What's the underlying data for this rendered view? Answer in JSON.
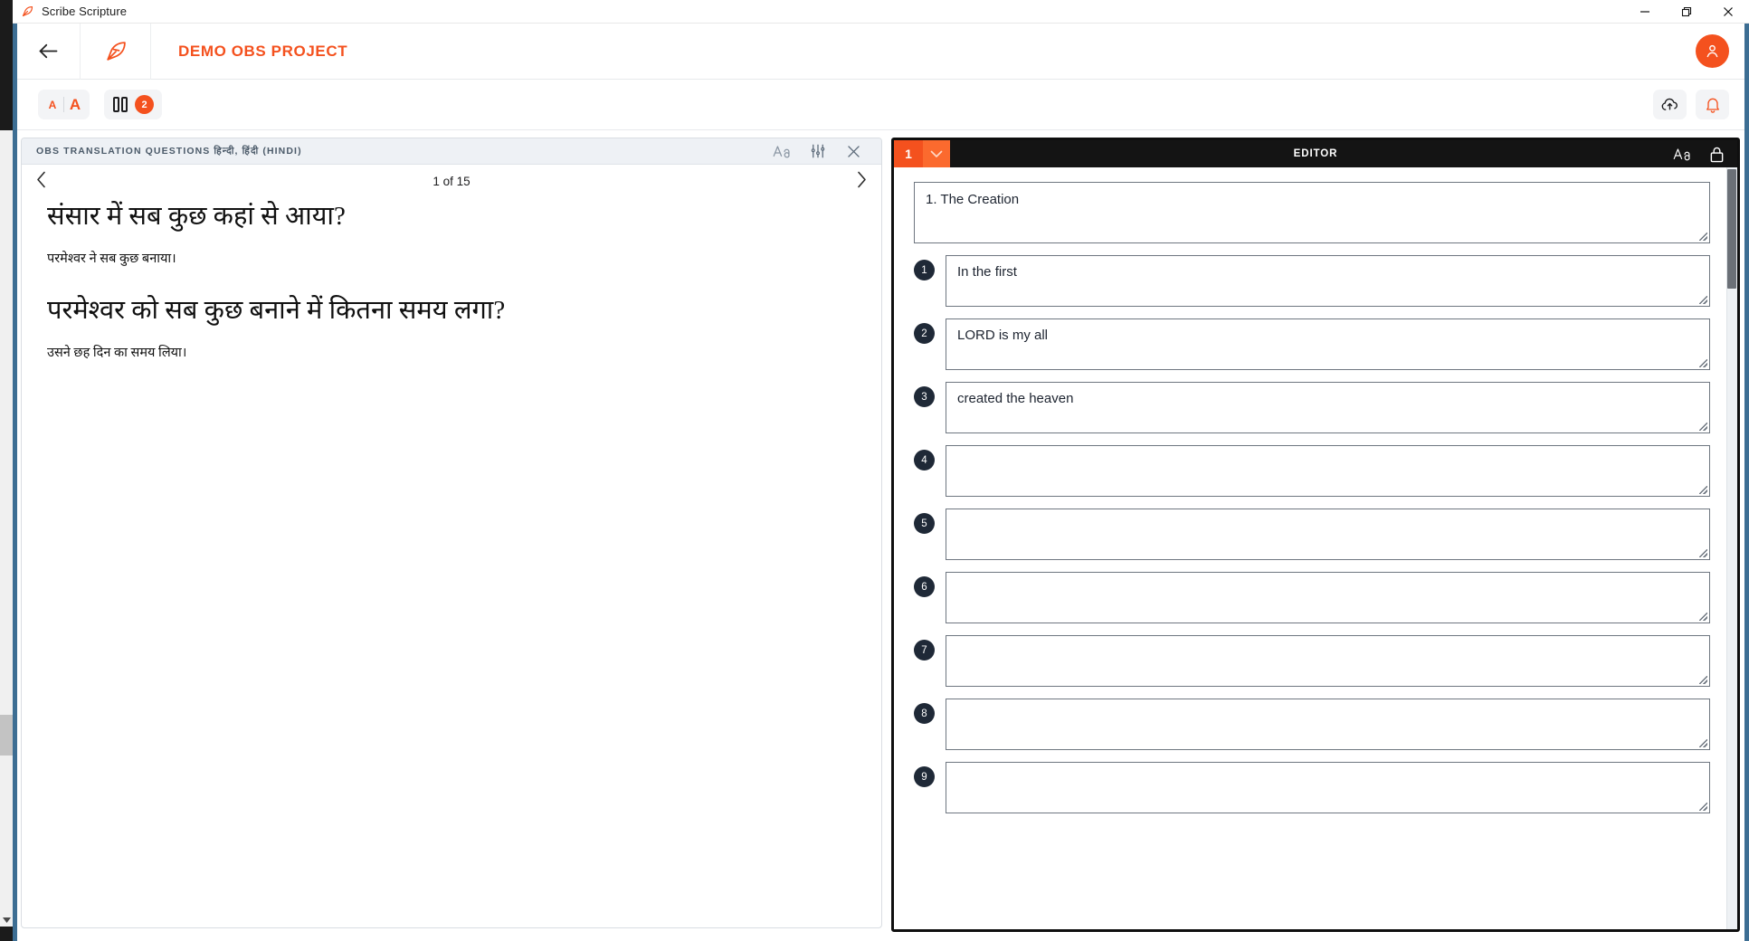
{
  "window": {
    "title": "Scribe Scripture",
    "app_icon": "feather-quill-icon",
    "controls": {
      "minimize": "—",
      "maximize": "❐",
      "close": "✕"
    }
  },
  "header": {
    "back_icon": "arrow-left-icon",
    "logo_icon": "feather-quill-icon",
    "project_title": "DEMO OBS PROJECT",
    "avatar_icon": "user-avatar-icon",
    "accent_color": "#f4511e"
  },
  "toolbar": {
    "font_small_label": "A",
    "font_large_label": "A",
    "columns_icon": "two-columns-icon",
    "columns_count": "2",
    "upload_icon": "cloud-upload-icon",
    "notification_icon": "bell-icon"
  },
  "resource_panel": {
    "title": "OBS TRANSLATION QUESTIONS हिन्दी, हिंदी (HINDI)",
    "font_icon": "font-size-icon",
    "settings_icon": "sliders-icon",
    "close_icon": "close-icon",
    "prev_icon": "chevron-left-icon",
    "next_icon": "chevron-right-icon",
    "counter": "1 of 15",
    "entries": [
      {
        "question": "संसार में सब कुछ कहां से आया?",
        "answer": "परमेश्वर ने सब कुछ बनाया।"
      },
      {
        "question": "परमेश्वर को सब कुछ बनाने में कितना समय लगा?",
        "answer": "उसने छह दिन का समय लिया।"
      }
    ]
  },
  "editor_panel": {
    "chapter_number": "1",
    "chapter_caret_icon": "chevron-down-icon",
    "title": "EDITOR",
    "font_icon": "font-size-icon",
    "lock_icon": "lock-icon",
    "story_title": "1. The Creation",
    "verses": [
      {
        "number": "1",
        "text": "In the first"
      },
      {
        "number": "2",
        "text": "LORD is my all"
      },
      {
        "number": "3",
        "text": "created the heaven"
      },
      {
        "number": "4",
        "text": ""
      },
      {
        "number": "5",
        "text": ""
      },
      {
        "number": "6",
        "text": ""
      },
      {
        "number": "7",
        "text": ""
      },
      {
        "number": "8",
        "text": ""
      },
      {
        "number": "9",
        "text": ""
      }
    ]
  }
}
